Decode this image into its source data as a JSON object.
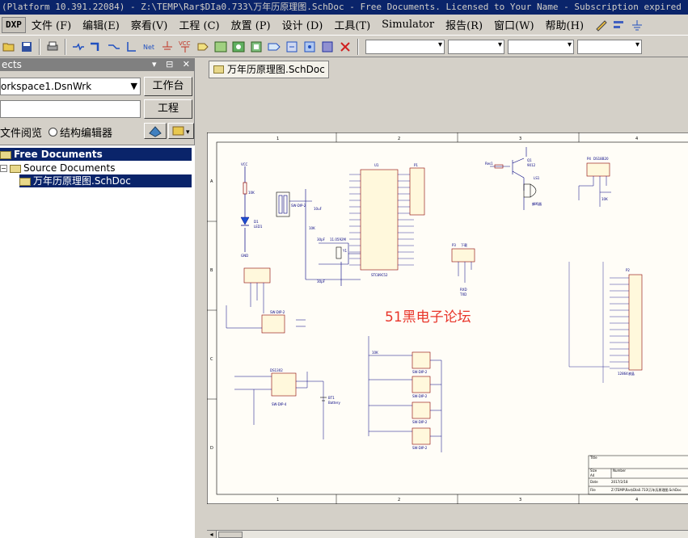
{
  "title_bar": {
    "text": "(Platform 10.391.22084) - Z:\\TEMP\\Rar$DIa0.733\\万年历原理图.SchDoc - Free Documents. Licensed to Your Name - Subscription expired"
  },
  "menu": {
    "dxp": "DXP",
    "items": [
      "文件 (F)",
      "编辑(E)",
      "察看(V)",
      "工程 (C)",
      "放置 (P)",
      "设计 (D)",
      "工具(T)",
      "Simulator",
      "报告(R)",
      "窗口(W)",
      "帮助(H)"
    ]
  },
  "panel": {
    "title": "ects",
    "workspace": "orkspace1.DsnWrk",
    "workspace_button": "工作台",
    "project_button": "工程",
    "view_mode_file": "文件阅览",
    "view_mode_struct": "结构编辑器",
    "tree": {
      "root": "Free Documents",
      "folder": "Source Documents",
      "document": "万年历原理图.SchDoc"
    }
  },
  "document_tab": {
    "label": "万年历原理图.SchDoc"
  },
  "schematic": {
    "border_columns": [
      "1",
      "2",
      "3",
      "4"
    ],
    "border_rows": [
      "A",
      "B",
      "C",
      "D"
    ],
    "watermark": "51黑电子论坛",
    "mcu_label": "STC89C52",
    "title_block": {
      "title": "Title",
      "size_label": "Size",
      "size": "A4",
      "number": "Number",
      "date_label": "Date",
      "date": "2017/2/18",
      "file_label": "File",
      "file": "Z:\\TEMP\\Rar$DIa0.733\\万年历原理图.SchDoc"
    },
    "labels": {
      "vcc": "VCC",
      "gnd": "GND",
      "lcd": "12864液晶",
      "lcd_ref": "P2",
      "buzzer": "蜂鸣器",
      "buzzer_ref": "LS1",
      "sensor": "DS18B20",
      "sensor_ref": "P4",
      "rtc": "DS1302",
      "battery": "BT1",
      "battery_name": "Battery",
      "crystal_freq": "11.0592M",
      "crystal": "Y1",
      "led": "D1",
      "led_name": "LED1",
      "transistor": "Q1",
      "transistor_type": "9012",
      "download": "下载",
      "download_ref": "P3",
      "rxd": "RXD",
      "txd": "TXD",
      "switch": "SW-DIP-2",
      "switch4": "SW-DIP-4",
      "port": "P1",
      "mcu_ref": "U1",
      "resistor_10k": "10K",
      "resistor": "Res1",
      "cap": "Cap",
      "cap_30p": "30pF",
      "cap_10u": "10uF"
    }
  },
  "colors": {
    "titlebar": "#0a246a",
    "selection": "#0a246a",
    "schematic_bg": "#fffdf7",
    "wire": "#000080",
    "component": "#8b0000",
    "watermark": "#e8352a"
  }
}
